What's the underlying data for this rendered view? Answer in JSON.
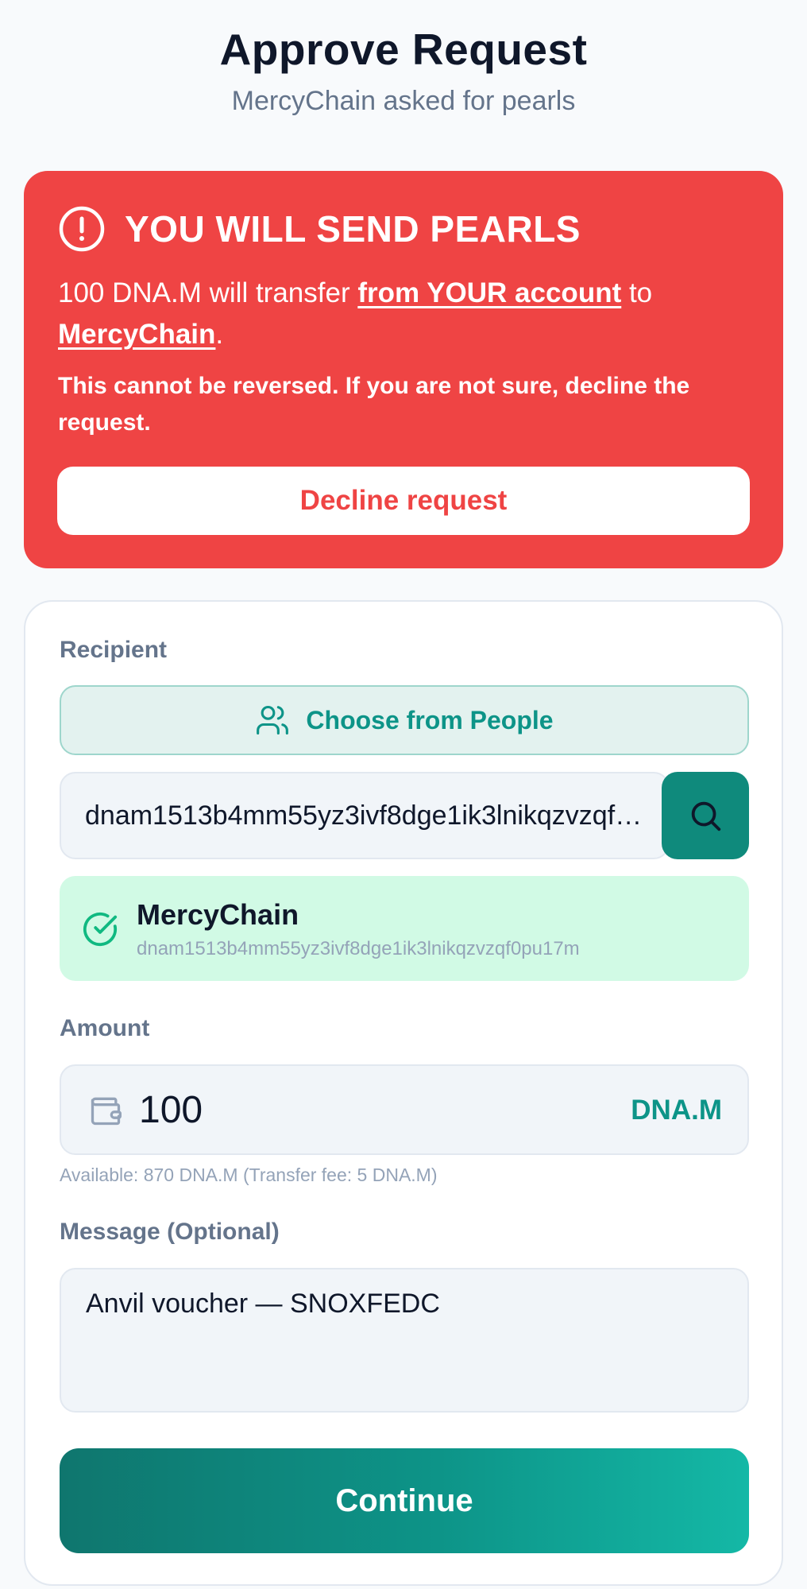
{
  "header": {
    "title": "Approve Request",
    "subtitle": "MercyChain asked for pearls"
  },
  "warning": {
    "title": "YOU WILL SEND PEARLS",
    "body_prefix": "100 DNA.M will transfer ",
    "body_emphasis": "from YOUR account",
    "body_middle": " to ",
    "body_recipient": "MercyChain",
    "body_suffix": ".",
    "note": "This cannot be reversed. If you are not sure, decline the request.",
    "decline_label": "Decline request",
    "color": "#ef4444"
  },
  "form": {
    "recipient_label": "Recipient",
    "choose_people_label": "Choose from People",
    "address_value": "dnam1513b4mm55yz3ivf8dge1ik3lnikqzvzqf0pu17m",
    "verified_name": "MercyChain",
    "verified_address": "dnam1513b4mm55yz3ivf8dge1ik3lnikqzvzqf0pu17m",
    "amount_label": "Amount",
    "amount_value": "100",
    "amount_unit": "DNA.M",
    "amount_hint": "Available: 870 DNA.M (Transfer fee: 5 DNA.M)",
    "message_label": "Message (Optional)",
    "message_value": "Anvil voucher — SNOXFEDC",
    "continue_label": "Continue",
    "accent": "#0d9488"
  }
}
